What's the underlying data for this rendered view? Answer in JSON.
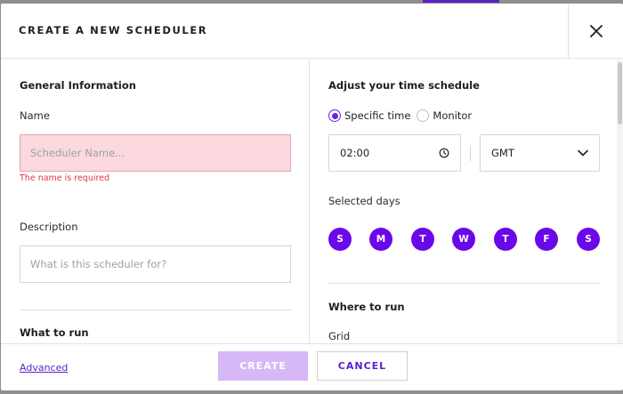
{
  "header": {
    "title": "CREATE A NEW SCHEDULER"
  },
  "left": {
    "general_title": "General Information",
    "name_label": "Name",
    "name_placeholder": "Scheduler Name...",
    "name_value": "",
    "name_error": "The name is required",
    "description_label": "Description",
    "description_placeholder": "What is this scheduler for?",
    "description_value": "",
    "what_to_run_title": "What to run"
  },
  "right": {
    "schedule_title": "Adjust your time schedule",
    "radio_options": [
      {
        "label": "Specific time",
        "checked": true
      },
      {
        "label": "Monitor",
        "checked": false
      }
    ],
    "time_value": "02:00",
    "timezone_selected": "GMT",
    "selected_days_label": "Selected days",
    "days": [
      "S",
      "M",
      "T",
      "W",
      "T",
      "F",
      "S"
    ],
    "where_to_run_title": "Where to run",
    "grid_label": "Grid"
  },
  "footer": {
    "advanced_label": "Advanced",
    "create_label": "CREATE",
    "cancel_label": "CANCEL"
  },
  "colors": {
    "accent": "#6b08ea",
    "error": "#e0354f",
    "error_bg": "#fbd9de",
    "create_disabled": "#d7b8f7"
  },
  "icons": [
    "close-icon",
    "clock-icon",
    "chevron-down-icon"
  ]
}
